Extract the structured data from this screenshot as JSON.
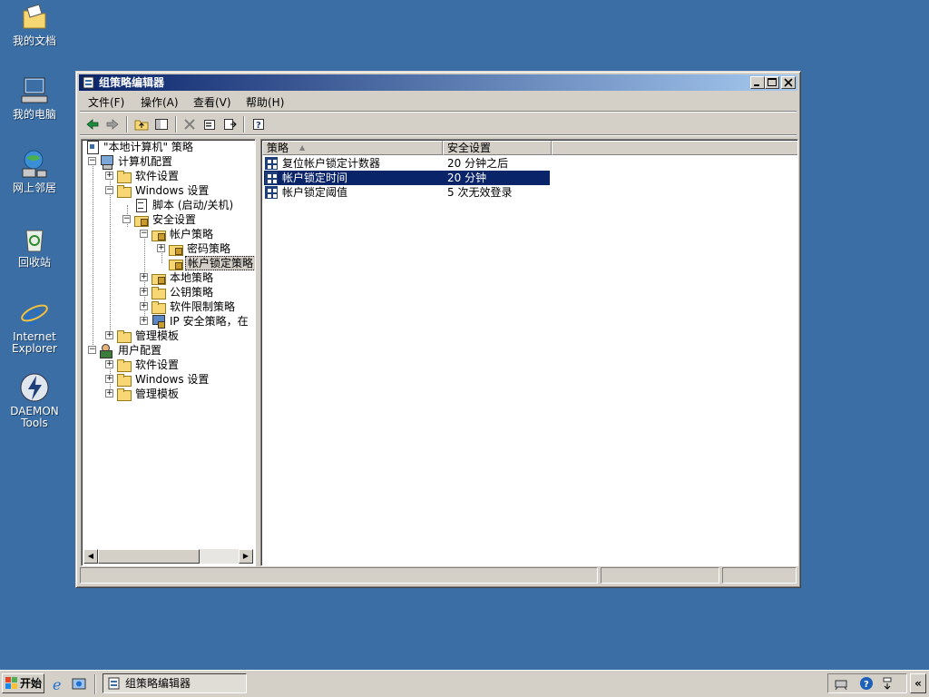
{
  "desktop": {
    "icons": [
      {
        "label": "我的文档"
      },
      {
        "label": "我的电脑"
      },
      {
        "label": "网上邻居"
      },
      {
        "label": "回收站"
      },
      {
        "label": "Internet Explorer"
      },
      {
        "label": "DAEMON Tools"
      }
    ]
  },
  "window": {
    "title": "组策略编辑器",
    "menu": [
      "文件(F)",
      "操作(A)",
      "查看(V)",
      "帮助(H)"
    ]
  },
  "tree": {
    "root": "\"本地计算机\" 策略",
    "items": [
      "计算机配置",
      "软件设置",
      "Windows 设置",
      "脚本 (启动/关机)",
      "安全设置",
      "帐户策略",
      "密码策略",
      "帐户锁定策略",
      "本地策略",
      "公钥策略",
      "软件限制策略",
      "IP 安全策略，在",
      "管理模板",
      "用户配置",
      "软件设置",
      "Windows 设置",
      "管理模板"
    ]
  },
  "list": {
    "columns": [
      "策略",
      "安全设置"
    ],
    "rows": [
      {
        "policy": "复位帐户锁定计数器",
        "setting": "20 分钟之后"
      },
      {
        "policy": "帐户锁定时间",
        "setting": "20 分钟"
      },
      {
        "policy": "帐户锁定阈值",
        "setting": "5 次无效登录"
      }
    ],
    "selected_index": 1
  },
  "taskbar": {
    "start_label": "开始",
    "task_title": "组策略编辑器"
  }
}
